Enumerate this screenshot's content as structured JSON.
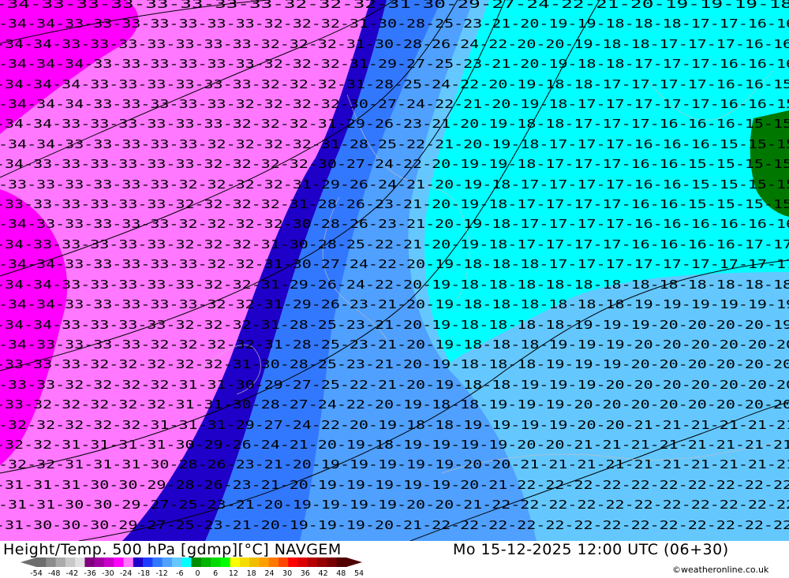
{
  "header": {
    "title": "Height/Temp. 500 hPa [gdmp][°C] NAVGEM",
    "datetime": "Mo 15-12-2025 12:00 UTC (06+30)",
    "credit": "©weatheronline.co.uk"
  },
  "legend": {
    "ticks": [
      "-54",
      "-48",
      "-42",
      "-36",
      "-30",
      "-24",
      "-18",
      "-12",
      "-6",
      "0",
      "6",
      "12",
      "18",
      "24",
      "30",
      "36",
      "42",
      "48",
      "54"
    ],
    "colors": [
      "#6e6e6e",
      "#8c8c8c",
      "#aaaaaa",
      "#c8c8c8",
      "#e1e1e1",
      "#800080",
      "#a000a0",
      "#c800c8",
      "#ff00ff",
      "#ff78ff",
      "#1e00c8",
      "#1e3cff",
      "#3278ff",
      "#50a0ff",
      "#64c8ff",
      "#00ffff",
      "#008c00",
      "#00b400",
      "#00dc00",
      "#00ff00",
      "#ffff00",
      "#f5dc00",
      "#f0be00",
      "#ffa000",
      "#ff7800",
      "#ff4600",
      "#ff0000",
      "#dc0000",
      "#b40000",
      "#960000",
      "#780000",
      "#500000"
    ]
  },
  "map": {
    "colors": {
      "magenta": "#ff00ff",
      "pink": "#ff78ff",
      "dark_blue": "#1e00c8",
      "blue": "#3278ff",
      "light_blue": "#50a0ff",
      "sky_blue": "#64c8ff",
      "cyan": "#00ffff",
      "dark_green": "#007800"
    },
    "isotherm_rows": [
      "-34-33-33-33-33-33-33-33-32-32-32-31-30-29-27-24-22-21-20-19-19-19-18",
      "-34-34-33-33-33-33-33-33-33-32-32-32-31-30-28-25-23-21-20-19-19-18-18-18-17-17-16-16",
      "-34-34-33-33-33-33-33-33-33-32-32-32-31-30-28-26-24-22-20-20-19-18-18-17-17-17-16-16",
      "-34-34-34-33-33-33-33-33-33-32-32-32-31-29-27-25-23-21-20-19-18-18-17-17-17-16-16-16",
      "-34-34-34-33-33-33-33-33-33-32-32-32-31-28-25-24-22-20-19-18-18-17-17-17-17-16-16-15",
      "-34-34-34-33-33-33-33-33-32-32-32-32-30-27-24-22-21-20-19-18-17-17-17-17-17-16-16-15",
      "-34-34-33-33-33-33-33-33-32-32-32-31-29-26-23-21-20-19-18-18-17-17-17-16-16-16-15-15",
      "-34-34-33-33-33-33-33-32-32-32-32-31-28-25-22-21-20-19-18-17-17-17-16-16-16-15-15-15",
      "-34-33-33-33-33-33-33-32-32-32-32-30-27-24-22-20-19-19-18-17-17-17-16-16-15-15-15-15",
      "-33-33-33-33-33-33-32-32-32-32-31-29-26-24-21-20-19-18-17-17-17-17-16-16-15-15-15-15",
      "-33-33-33-33-33-33-32-32-32-32-31-28-26-23-21-20-19-18-17-17-17-17-16-16-15-15-15-15",
      "-34-33-33-33-33-33-32-32-32-32-30-28-26-23-21-20-19-18-17-17-17-17-16-16-16-16-16-16",
      "-34-33-33-33-33-33-32-32-32-31-30-28-25-22-21-20-19-18-17-17-17-17-16-16-16-16-17-17",
      "-34-34-33-33-33-33-33-32-32-31-30-27-24-22-20-19-18-18-18-17-17-17-17-17-17-17-17-17",
      "-34-34-33-33-33-33-33-32-32-31-29-26-24-22-20-19-18-18-18-18-18-18-18-18-18-18-18-18",
      "-34-34-33-33-33-33-33-32-32-31-29-26-23-21-20-19-18-18-18-18-18-18-19-19-19-19-19-19",
      "-34-34-33-33-33-33-32-32-32-31-28-25-23-21-20-19-18-18-18-18-19-19-19-20-20-20-20-19",
      "-34-33-33-33-33-32-32-32-32-31-28-25-23-21-20-19-18-18-18-19-19-19-20-20-20-20-20-20",
      "-33-33-33-32-32-32-32-32-31-30-28-25-23-21-20-19-18-18-18-19-19-19-20-20-20-20-20-20",
      "-33-33-32-32-32-32-31-31-30-29-27-25-22-21-20-19-18-18-19-19-19-20-20-20-20-20-20-20",
      "-33-32-32-32-32-32-31-31-30-28-27-24-22-20-19-18-18-19-19-19-20-20-20-20-20-20-20-20",
      "-32-32-32-32-32-31-31-31-29-27-24-22-20-19-18-18-19-19-19-19-20-20-21-21-21-21-21-21",
      "-32-32-31-31-31-31-30-29-26-24-21-20-19-18-19-19-19-19-20-20-21-21-21-21-21-21-21-21",
      "-32-32-31-31-31-30-28-26-23-21-20-19-19-19-19-19-20-20-21-21-21-21-21-21-21-21-21-21",
      "-31-31-31-30-30-29-28-26-23-21-20-19-19-19-19-19-20-21-22-22-22-22-22-22-22-22-22-22",
      "-31-31-30-30-29-27-25-23-21-20-19-19-19-19-20-20-21-22-22-22-22-22-22-22-22-22-22-22",
      "-31-30-30-30-29-27-25-23-21-20-19-19-19-20-21-22-22-22-22-22-22-22-22-22-22-22-22-22"
    ]
  }
}
